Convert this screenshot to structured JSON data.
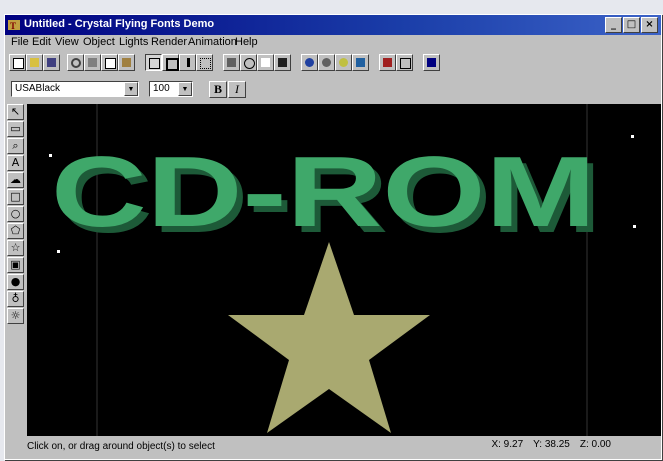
{
  "window": {
    "title": "Untitled - Crystal Flying Fonts Demo",
    "controls": [
      "_",
      "□",
      "×"
    ]
  },
  "menu": [
    "File",
    "Edit",
    "View",
    "Object",
    "Lights",
    "Render",
    "Animation",
    "Help"
  ],
  "format": {
    "font_name": "USABlack",
    "font_size": "100",
    "bold_label": "B",
    "italic_label": "I"
  },
  "canvas": {
    "text": "CD-ROM",
    "text_color": "#3fa86a",
    "star_color": "#a9a970",
    "background": "#000000"
  },
  "status": {
    "message": "Click on, or drag around object(s) to select",
    "x": "X: 9.27",
    "y": "Y: 38.25",
    "z": "Z: 0.00"
  }
}
